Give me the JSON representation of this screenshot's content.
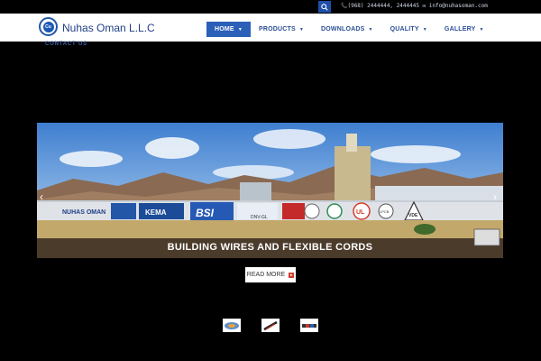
{
  "topbar": {
    "contact_text": "📞(968) 2444444, 2444445   ✉ info@nuhasoman.com"
  },
  "brand": {
    "logo_symbol": "Cu",
    "name": "Nuhas Oman L.L.C"
  },
  "nav": {
    "items": [
      {
        "label": "HOME",
        "active": true
      },
      {
        "label": "PRODUCTS"
      },
      {
        "label": "DOWNLOADS"
      },
      {
        "label": "QUALITY"
      },
      {
        "label": "GALLERY"
      }
    ],
    "contact_label": "CONTACT US"
  },
  "slider": {
    "caption": "BUILDING WIRES AND FLEXIBLE CORDS",
    "readmore_label": "READ MORE",
    "cert_logos": [
      "KEMA",
      "BSI",
      "DNV-GL",
      "UL",
      "LPCB",
      "VDE"
    ],
    "wall_text": "NUHAS OMAN"
  },
  "thumbnails": [
    "thumbnail-1",
    "thumbnail-2",
    "thumbnail-3"
  ],
  "colors": {
    "accent": "#2c5fb8",
    "brand_text": "#1f3f85",
    "background": "#000000"
  }
}
